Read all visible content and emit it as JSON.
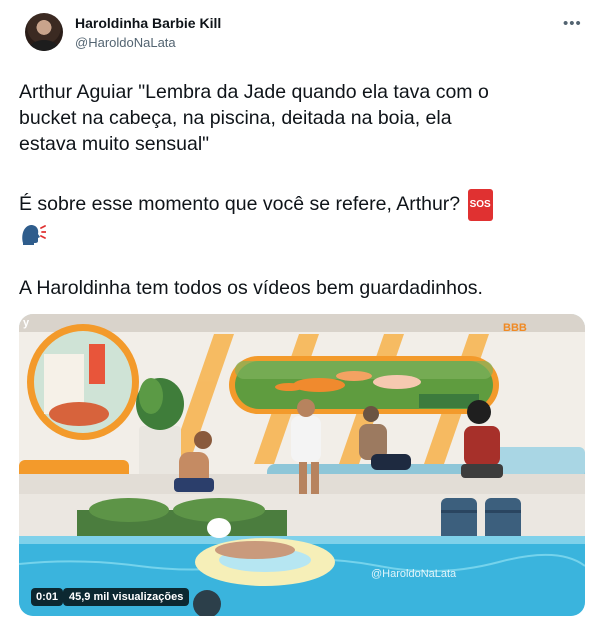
{
  "author": {
    "name": "Haroldinha Barbie Kill",
    "handle": "@HaroldoNaLata"
  },
  "tweet": {
    "line1": "Arthur Aguiar \"Lembra da Jade quando ela tava com o",
    "line2": "bucket na cabeça, na piscina, deitada na boia, ela",
    "line3": "estava muito sensual\"",
    "line4": "É sobre esse momento que você se refere, Arthur?",
    "sos_label": "SOS",
    "line6": "A Haroldinha tem todos os vídeos bem guardadinhos."
  },
  "video": {
    "watermark": "@HaroldoNaLata",
    "badge": "BBB",
    "corner_mark": "y",
    "time": "0:01",
    "views": "45,9 mil visualizações"
  },
  "icons": {
    "more": "more-options-icon",
    "speaking_head": "speaking-head-icon",
    "sos": "sos-icon"
  },
  "colors": {
    "text": "#0f1419",
    "secondary": "#536471",
    "sos_red": "#e03131"
  }
}
